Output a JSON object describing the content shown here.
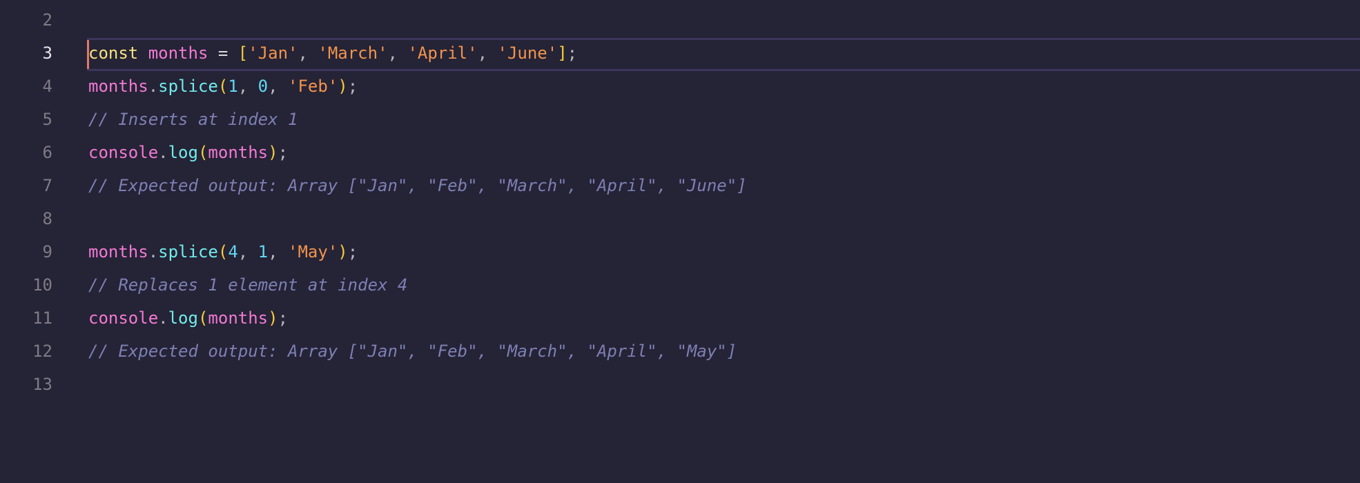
{
  "editor": {
    "active_line": 3,
    "colors": {
      "background": "#252336",
      "cursor": "#e07a6c",
      "current_line_border": "#3d365c"
    },
    "lines": [
      {
        "number": "2",
        "tokens": []
      },
      {
        "number": "3",
        "tokens": [
          [
            "keyword",
            "const"
          ],
          [
            "op",
            " "
          ],
          [
            "var",
            "months"
          ],
          [
            "op",
            " = "
          ],
          [
            "bracket",
            "["
          ],
          [
            "string",
            "'Jan'"
          ],
          [
            "punct",
            ", "
          ],
          [
            "string",
            "'March'"
          ],
          [
            "punct",
            ", "
          ],
          [
            "string",
            "'April'"
          ],
          [
            "punct",
            ", "
          ],
          [
            "string",
            "'June'"
          ],
          [
            "bracket",
            "]"
          ],
          [
            "punct",
            ";"
          ]
        ]
      },
      {
        "number": "4",
        "tokens": [
          [
            "var",
            "months"
          ],
          [
            "punct",
            "."
          ],
          [
            "func",
            "splice"
          ],
          [
            "bracket",
            "("
          ],
          [
            "number",
            "1"
          ],
          [
            "punct",
            ", "
          ],
          [
            "number",
            "0"
          ],
          [
            "punct",
            ", "
          ],
          [
            "string",
            "'Feb'"
          ],
          [
            "bracket",
            ")"
          ],
          [
            "punct",
            ";"
          ]
        ]
      },
      {
        "number": "5",
        "tokens": [
          [
            "comment",
            "// Inserts at index 1"
          ]
        ]
      },
      {
        "number": "6",
        "tokens": [
          [
            "var",
            "console"
          ],
          [
            "punct",
            "."
          ],
          [
            "func",
            "log"
          ],
          [
            "bracket",
            "("
          ],
          [
            "var",
            "months"
          ],
          [
            "bracket",
            ")"
          ],
          [
            "punct",
            ";"
          ]
        ]
      },
      {
        "number": "7",
        "tokens": [
          [
            "comment",
            "// Expected output: Array [\"Jan\", \"Feb\", \"March\", \"April\", \"June\"]"
          ]
        ]
      },
      {
        "number": "8",
        "tokens": []
      },
      {
        "number": "9",
        "tokens": [
          [
            "var",
            "months"
          ],
          [
            "punct",
            "."
          ],
          [
            "func",
            "splice"
          ],
          [
            "bracket",
            "("
          ],
          [
            "number",
            "4"
          ],
          [
            "punct",
            ", "
          ],
          [
            "number",
            "1"
          ],
          [
            "punct",
            ", "
          ],
          [
            "string",
            "'May'"
          ],
          [
            "bracket",
            ")"
          ],
          [
            "punct",
            ";"
          ]
        ]
      },
      {
        "number": "10",
        "tokens": [
          [
            "comment",
            "// Replaces 1 element at index 4"
          ]
        ]
      },
      {
        "number": "11",
        "tokens": [
          [
            "var",
            "console"
          ],
          [
            "punct",
            "."
          ],
          [
            "func",
            "log"
          ],
          [
            "bracket",
            "("
          ],
          [
            "var",
            "months"
          ],
          [
            "bracket",
            ")"
          ],
          [
            "punct",
            ";"
          ]
        ]
      },
      {
        "number": "12",
        "tokens": [
          [
            "comment",
            "// Expected output: Array [\"Jan\", \"Feb\", \"March\", \"April\", \"May\"]"
          ]
        ]
      },
      {
        "number": "13",
        "tokens": []
      }
    ]
  }
}
